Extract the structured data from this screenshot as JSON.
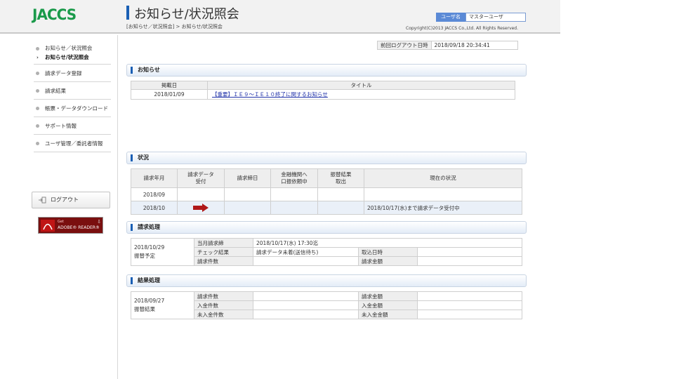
{
  "header": {
    "logo": "JACCS",
    "title": "お知らせ/状況照会",
    "breadcrumb": "[お知らせ／状況照会] > お知らせ/状況照会",
    "user_label": "ユーザ名",
    "user_name": "マスターユーザ",
    "copyright": "Copyright(C)2013 JACCS Co.,Ltd. All Rights Reserved."
  },
  "sidebar": {
    "items": [
      {
        "label": "お知らせ／状況照会"
      },
      {
        "label": "お知らせ/状況照会"
      },
      {
        "label": "請求データ登録"
      },
      {
        "label": "請求結果"
      },
      {
        "label": "帳票・データダウンロード"
      },
      {
        "label": "サポート情報"
      },
      {
        "label": "ユーザ管理／委託者情報"
      }
    ],
    "logout_label": "ログアウト",
    "adobe_get": "Get",
    "adobe_reader": "ADOBE® READER®"
  },
  "main": {
    "last_logout_label": "前回ログアウト日時",
    "last_logout_value": "2018/09/18 20:34:41",
    "notice": {
      "section_title": "お知らせ",
      "headers": [
        "掲載日",
        "タイトル"
      ],
      "rows": [
        {
          "date": "2018/01/09",
          "title": "【重要】ＩＥ９～ＩＥ１０終了に関するお知らせ"
        }
      ]
    },
    "status": {
      "section_title": "状況",
      "headers": [
        "請求年月",
        "請求データ受付",
        "請求締日",
        "金融機関へ口振依頼中",
        "振替結果取出",
        "現在の状況"
      ],
      "header_line1": [
        "請求データ",
        "金融機関へ",
        "振替結果"
      ],
      "header_line2": [
        "受付",
        "口振依頼中",
        "取出"
      ],
      "rows": [
        {
          "month": "2018/09",
          "status": ""
        },
        {
          "month": "2018/10",
          "status": "2018/10/17(水)まで請求データ受付中"
        }
      ]
    },
    "billing": {
      "section_title": "請求処理",
      "date": "2018/10/29",
      "date_sub": "振替予定",
      "labels": [
        "当月請求締",
        "チェック結果",
        "請求件数",
        "取込日時",
        "請求金額"
      ],
      "deadline": "2018/10/17(水) 17:30迄",
      "check_result": "請求データ未着(送信待ち)"
    },
    "result": {
      "section_title": "結果処理",
      "date": "2018/09/27",
      "date_sub": "振替結果",
      "labels": [
        "請求件数",
        "入金件数",
        "未入金件数",
        "請求金額",
        "入金金額",
        "未入金金額"
      ]
    }
  },
  "colors": {
    "accent": "#1a5fb4",
    "logo": "#1a9a4a",
    "arrow": "#b01818",
    "link": "#2233aa"
  }
}
